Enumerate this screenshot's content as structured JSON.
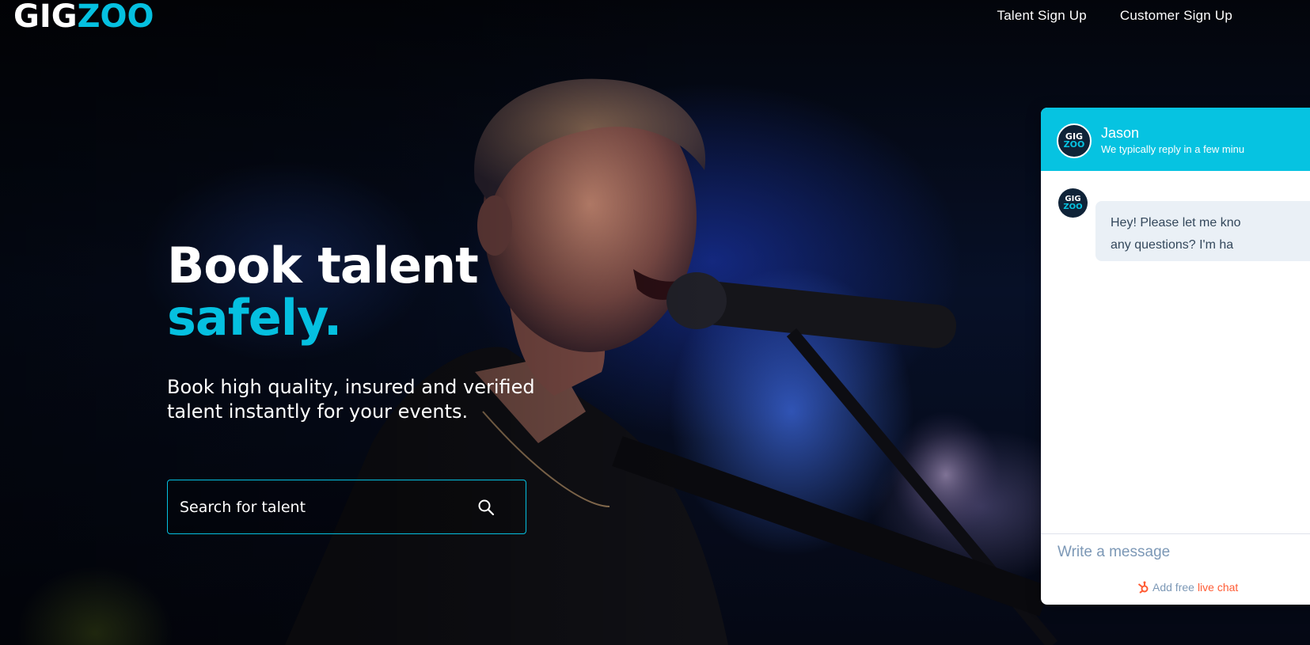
{
  "header": {
    "logo": {
      "part1": "GIG",
      "part2": "ZOO"
    },
    "nav": [
      {
        "label": "Talent Sign Up"
      },
      {
        "label": "Customer Sign Up"
      }
    ]
  },
  "hero": {
    "headline_line1": "Book talent",
    "headline_line2": "safely.",
    "subheadline": "Book high quality, insured and verified talent instantly for your events.",
    "search": {
      "placeholder": "Search for talent",
      "icon": "search-icon"
    }
  },
  "chat": {
    "avatar_text": {
      "line1": "GIG",
      "line2": "ZOO"
    },
    "agent_name": "Jason",
    "agent_status": "We typically reply in a few minu",
    "message_line1": "Hey! Please let me kno",
    "message_line2": "any questions?  I'm ha",
    "input_placeholder": "Write a message",
    "footer_prefix": "Add free ",
    "footer_link": "live chat",
    "footer_icon": "hubspot-sprocket-icon"
  },
  "colors": {
    "accent": "#05c0e0",
    "chat_header": "#06c3e1",
    "chat_link": "#ff5c35"
  }
}
